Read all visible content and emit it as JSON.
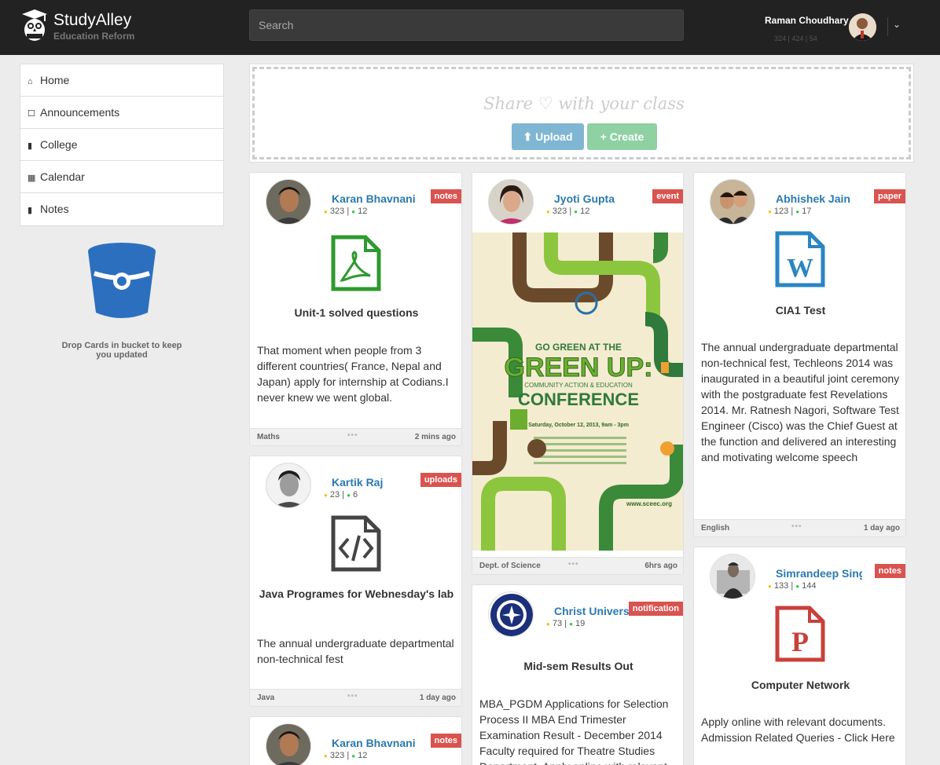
{
  "app": {
    "brand": "StudyAlley",
    "subtitle": "Education Reform"
  },
  "search": {
    "placeholder": "Search"
  },
  "user": {
    "name": "Raman Choudhary",
    "stats": "324 | 424 | 54"
  },
  "sidebar": {
    "items": [
      {
        "label": "Home",
        "icon": "home-icon"
      },
      {
        "label": "Announcements",
        "icon": "bell-icon"
      },
      {
        "label": "College",
        "icon": "book-icon"
      },
      {
        "label": "Calendar",
        "icon": "calendar-icon"
      },
      {
        "label": "Notes",
        "icon": "book-icon"
      }
    ],
    "bucket_text": "Drop Cards in bucket to keep you updated"
  },
  "share": {
    "title": "Share ♡ with your class",
    "upload_label": "Upload",
    "create_label": "Create"
  },
  "colors": {
    "topbar": "#222222",
    "link": "#2a7ab0",
    "tag": "#d9534f",
    "upload": "#7fb6d4",
    "create": "#8fd1a3"
  },
  "cards": [
    {
      "author": "Karan Bhavnani",
      "points": "323",
      "followers": "12",
      "tag": "notes",
      "icon": "pdf-file-icon",
      "title": "Unit-1 solved questions",
      "desc": "That moment when people from 3 different countries( France, Nepal and Japan) apply for internship at Codians.I never knew we went global.",
      "subject": "Maths",
      "time": "2 mins ago"
    },
    {
      "author": "Kartik Raj",
      "points": "23",
      "followers": "6",
      "tag": "uploads",
      "icon": "code-file-icon",
      "title": "Java Programes for Webnesday's lab",
      "desc": "The annual undergraduate departmental non-technical fest",
      "subject": "Java",
      "time": "1 day ago"
    },
    {
      "author": "Karan Bhavnani",
      "points": "323",
      "followers": "12",
      "tag": "notes"
    },
    {
      "author": "Jyoti Gupta",
      "points": "323",
      "followers": "12",
      "tag": "event",
      "poster": {
        "headline1": "GO GREEN AT THE",
        "headline2": "GREEN UP:",
        "headline3": "COMMUNITY ACTION & EDUCATION",
        "headline4": "CONFERENCE",
        "date": "Saturday, October 12, 2013, 9am - 3pm",
        "site": "www.sceec.org"
      },
      "subject": "Dept. of Science",
      "time": "6hrs ago"
    },
    {
      "author": "Christ University",
      "points": "73",
      "followers": "19",
      "tag": "notification",
      "title": "Mid-sem Results Out",
      "desc": "MBA_PGDM Applications for Selection Process II MBA End Trimester Examination Result - December 2014 Faculty required for Theatre Studies Department. Apply online with relevant"
    },
    {
      "author": "Abhishek Jain",
      "points": "123",
      "followers": "17",
      "tag": "paper",
      "icon": "word-file-icon",
      "title": "CIA1 Test",
      "desc": "The annual undergraduate departmental non-technical fest, Techleons 2014 was inaugurated in a beautiful joint ceremony with the postgraduate fest Revelations 2014. Mr. Ratnesh Nagori, Software Test Engineer (Cisco) was the Chief Guest at the function and delivered an interesting and motivating welcome speech",
      "subject": "English",
      "time": "1 day ago"
    },
    {
      "author": "Simrandeep Singh",
      "points": "133",
      "followers": "144",
      "tag": "notes",
      "icon": "powerpoint-file-icon",
      "title": "Computer Network",
      "desc": "Apply online with relevant documents. Admission Related Queries - Click Here"
    }
  ]
}
